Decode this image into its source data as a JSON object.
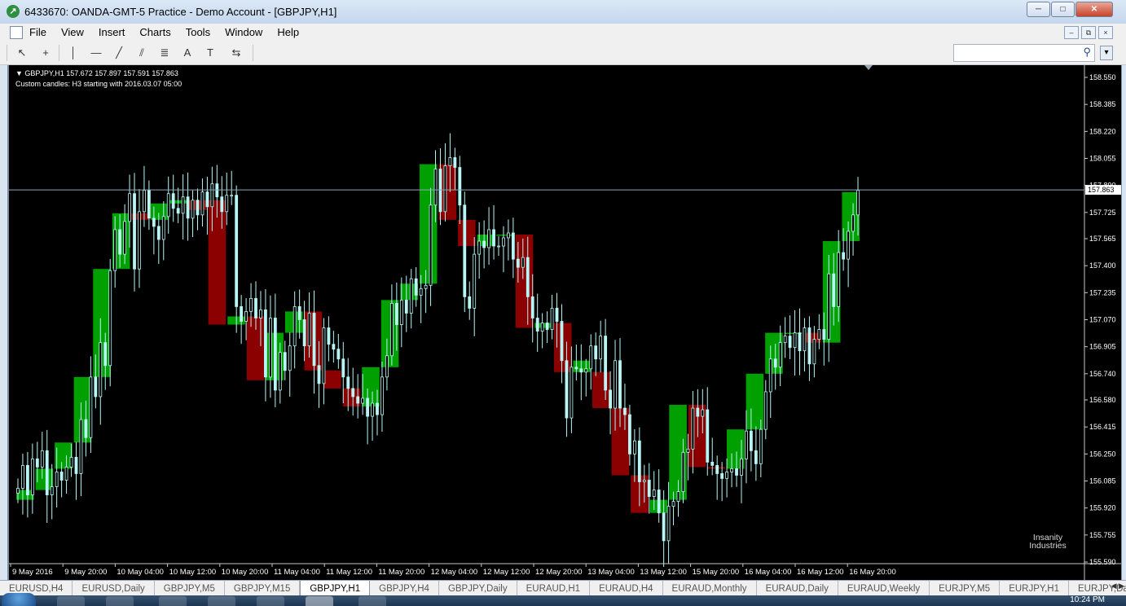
{
  "window": {
    "title": "6433670: OANDA-GMT-5 Practice - Demo Account - [GBPJPY,H1]",
    "buttons": [
      "─",
      "□",
      "✕"
    ]
  },
  "menu": {
    "items": [
      "File",
      "View",
      "Insert",
      "Charts",
      "Tools",
      "Window",
      "Help"
    ],
    "mdi_buttons": [
      "–",
      "⧉",
      "×"
    ]
  },
  "toolbar": {
    "search_placeholder": "",
    "tools": [
      {
        "icon": "cursor-icon",
        "glyph": "↖"
      },
      {
        "icon": "crosshair-icon",
        "glyph": "+"
      },
      {
        "icon": "vertical-line-icon",
        "glyph": "│"
      },
      {
        "icon": "horizontal-line-icon",
        "glyph": "—"
      },
      {
        "icon": "trendline-icon",
        "glyph": "╱"
      },
      {
        "icon": "equidistant-channel-icon",
        "glyph": "⫽"
      },
      {
        "icon": "fibonacci-icon",
        "glyph": "≣"
      },
      {
        "icon": "text-icon",
        "glyph": "A"
      },
      {
        "icon": "text-label-icon",
        "glyph": "T"
      },
      {
        "icon": "arrows-icon",
        "glyph": "⇆"
      }
    ]
  },
  "chart": {
    "info_line": "GBPJPY,H1  157.672 157.897 157.591 157.863",
    "subtitle": "Custom candles: H3 starting with 2016.03.07 05:00",
    "watermark": "Insanity Industries",
    "colors": {
      "bull_fill": "#00a000",
      "bear_fill": "#8b0000",
      "h1_wick": "#b8f6f6",
      "current_line": "#8ea6b8"
    }
  },
  "chart_data": {
    "type": "candlestick",
    "symbol": "GBPJPY",
    "timeframe": "H1",
    "ylim": [
      155.59,
      158.55
    ],
    "y_ticks": [
      "158.550",
      "158.385",
      "158.220",
      "158.055",
      "157.890",
      "157.725",
      "157.565",
      "157.400",
      "157.235",
      "157.070",
      "156.905",
      "156.740",
      "156.580",
      "156.415",
      "156.250",
      "156.085",
      "155.920",
      "155.755",
      "155.590"
    ],
    "current_price": "157.863",
    "x_labels": [
      "9 May 2016",
      "9 May 20:00",
      "10 May 04:00",
      "10 May 12:00",
      "10 May 20:00",
      "11 May 04:00",
      "11 May 12:00",
      "11 May 20:00",
      "12 May 04:00",
      "12 May 12:00",
      "12 May 20:00",
      "13 May 04:00",
      "13 May 12:00",
      "15 May 20:00",
      "16 May 04:00",
      "16 May 12:00",
      "16 May 20:00"
    ],
    "h3_candles": [
      {
        "o": 155.97,
        "h": 156.28,
        "l": 155.95,
        "c": 156.03
      },
      {
        "o": 156.03,
        "h": 156.18,
        "l": 155.99,
        "c": 156.16
      },
      {
        "o": 156.16,
        "h": 156.41,
        "l": 156.09,
        "c": 156.32
      },
      {
        "o": 156.32,
        "h": 156.85,
        "l": 156.24,
        "c": 156.72
      },
      {
        "o": 156.72,
        "h": 157.52,
        "l": 156.66,
        "c": 157.38
      },
      {
        "o": 157.38,
        "h": 157.87,
        "l": 157.31,
        "c": 157.72
      },
      {
        "o": 157.72,
        "h": 157.86,
        "l": 157.45,
        "c": 157.68
      },
      {
        "o": 157.68,
        "h": 157.86,
        "l": 157.6,
        "c": 157.78
      },
      {
        "o": 157.78,
        "h": 157.95,
        "l": 157.7,
        "c": 157.8
      },
      {
        "o": 157.8,
        "h": 157.86,
        "l": 157.68,
        "c": 157.74
      },
      {
        "o": 157.8,
        "h": 157.88,
        "l": 157.08,
        "c": 157.04
      },
      {
        "o": 157.04,
        "h": 157.4,
        "l": 156.89,
        "c": 157.09
      },
      {
        "o": 157.09,
        "h": 157.3,
        "l": 156.55,
        "c": 156.7
      },
      {
        "o": 156.7,
        "h": 157.08,
        "l": 156.54,
        "c": 156.99
      },
      {
        "o": 156.99,
        "h": 157.31,
        "l": 156.82,
        "c": 157.12
      },
      {
        "o": 157.12,
        "h": 157.16,
        "l": 156.69,
        "c": 156.76
      },
      {
        "o": 156.76,
        "h": 156.92,
        "l": 156.58,
        "c": 156.65
      },
      {
        "o": 156.65,
        "h": 156.81,
        "l": 156.53,
        "c": 156.54
      },
      {
        "o": 156.54,
        "h": 156.82,
        "l": 156.38,
        "c": 156.78
      },
      {
        "o": 156.78,
        "h": 157.21,
        "l": 156.69,
        "c": 157.19
      },
      {
        "o": 157.19,
        "h": 157.27,
        "l": 157.03,
        "c": 157.29
      },
      {
        "o": 157.29,
        "h": 158.15,
        "l": 157.21,
        "c": 158.02
      },
      {
        "o": 158.02,
        "h": 158.46,
        "l": 157.63,
        "c": 157.68
      },
      {
        "o": 157.68,
        "h": 157.8,
        "l": 157.05,
        "c": 157.52
      },
      {
        "o": 157.52,
        "h": 157.85,
        "l": 157.48,
        "c": 157.59
      },
      {
        "o": 157.59,
        "h": 157.74,
        "l": 157.35,
        "c": 157.59
      },
      {
        "o": 157.59,
        "h": 157.61,
        "l": 156.9,
        "c": 157.02
      },
      {
        "o": 157.02,
        "h": 157.12,
        "l": 156.94,
        "c": 157.05
      },
      {
        "o": 157.05,
        "h": 157.07,
        "l": 156.29,
        "c": 156.75
      },
      {
        "o": 156.75,
        "h": 156.95,
        "l": 156.55,
        "c": 156.82
      },
      {
        "o": 156.75,
        "h": 157.17,
        "l": 156.44,
        "c": 156.53
      },
      {
        "o": 156.53,
        "h": 156.85,
        "l": 156.35,
        "c": 156.12
      },
      {
        "o": 156.12,
        "h": 156.35,
        "l": 155.82,
        "c": 155.89
      },
      {
        "o": 155.89,
        "h": 156.03,
        "l": 155.67,
        "c": 155.97
      },
      {
        "o": 155.97,
        "h": 156.64,
        "l": 155.83,
        "c": 156.55
      },
      {
        "o": 156.55,
        "h": 156.57,
        "l": 156.07,
        "c": 156.17
      },
      {
        "o": 156.17,
        "h": 156.27,
        "l": 155.96,
        "c": 156.16
      },
      {
        "o": 156.16,
        "h": 156.46,
        "l": 156.07,
        "c": 156.4
      },
      {
        "o": 156.4,
        "h": 156.88,
        "l": 156.32,
        "c": 156.74
      },
      {
        "o": 156.74,
        "h": 157.05,
        "l": 156.65,
        "c": 156.99
      },
      {
        "o": 156.99,
        "h": 157.11,
        "l": 156.78,
        "c": 156.99
      },
      {
        "o": 156.99,
        "h": 157.17,
        "l": 156.83,
        "c": 156.93
      },
      {
        "o": 156.93,
        "h": 157.64,
        "l": 156.88,
        "c": 157.55
      },
      {
        "o": 157.55,
        "h": 157.92,
        "l": 157.48,
        "c": 157.85
      }
    ],
    "h1_closes": [
      156.04,
      156.18,
      156.0,
      156.22,
      156.17,
      156.27,
      156.0,
      156.05,
      156.14,
      156.09,
      156.17,
      156.23,
      156.13,
      156.46,
      156.35,
      156.72,
      156.6,
      156.93,
      156.79,
      157.37,
      157.62,
      157.47,
      157.67,
      157.84,
      157.38,
      157.73,
      157.86,
      157.69,
      157.64,
      157.56,
      157.7,
      157.84,
      157.75,
      157.72,
      157.82,
      157.69,
      157.8,
      157.71,
      157.85,
      157.76,
      157.9,
      157.82,
      157.73,
      157.83,
      157.83,
      157.15,
      157.06,
      157.12,
      157.2,
      157.08,
      157.13,
      156.72,
      157.08,
      156.64,
      156.87,
      156.76,
      156.91,
      157.15,
      157.07,
      156.91,
      157.11,
      156.79,
      156.68,
      157.02,
      156.92,
      156.89,
      156.83,
      156.72,
      156.65,
      156.6,
      156.56,
      156.59,
      156.48,
      156.56,
      156.49,
      156.72,
      156.85,
      157.17,
      157.04,
      157.19,
      157.11,
      157.32,
      157.22,
      157.26,
      157.28,
      157.77,
      157.99,
      157.73,
      158.01,
      158.06,
      158.0,
      157.77,
      157.21,
      157.14,
      157.47,
      157.55,
      157.51,
      157.62,
      157.52,
      157.52,
      157.57,
      157.6,
      157.44,
      157.39,
      157.45,
      157.21,
      157.08,
      157.0,
      157.05,
      157.01,
      157.14,
      157.06,
      156.82,
      156.47,
      156.78,
      156.77,
      156.75,
      156.77,
      156.91,
      156.83,
      156.97,
      156.64,
      156.53,
      156.82,
      156.53,
      156.49,
      156.25,
      156.33,
      156.08,
      156.09,
      155.99,
      156.03,
      155.89,
      155.72,
      155.93,
      155.96,
      156.02,
      156.26,
      156.28,
      156.53,
      156.48,
      156.52,
      156.2,
      156.18,
      156.13,
      156.1,
      156.14,
      156.16,
      156.12,
      156.22,
      156.39,
      156.27,
      156.19,
      156.4,
      156.63,
      156.83,
      156.78,
      156.93,
      156.97,
      156.9,
      156.99,
      156.88,
      157.02,
      156.8,
      156.95,
      157.01,
      156.95,
      157.35,
      157.15,
      157.48,
      157.44,
      157.61,
      157.71,
      157.86
    ]
  },
  "tabs": {
    "items": [
      "EURUSD,H4",
      "EURUSD,Daily",
      "GBPJPY,M5",
      "GBPJPY,M15",
      "GBPJPY,H1",
      "GBPJPY,H4",
      "GBPJPY,Daily",
      "EURAUD,H1",
      "EURAUD,H4",
      "EURAUD,Monthly",
      "EURAUD,Daily",
      "EURAUD,Weekly",
      "EURJPY,M5",
      "EURJPY,H1",
      "EURJPY,Daily"
    ],
    "active": "GBPJPY,H1",
    "arrows": "◀ ▶"
  },
  "taskbar": {
    "time": "10:24 PM"
  }
}
